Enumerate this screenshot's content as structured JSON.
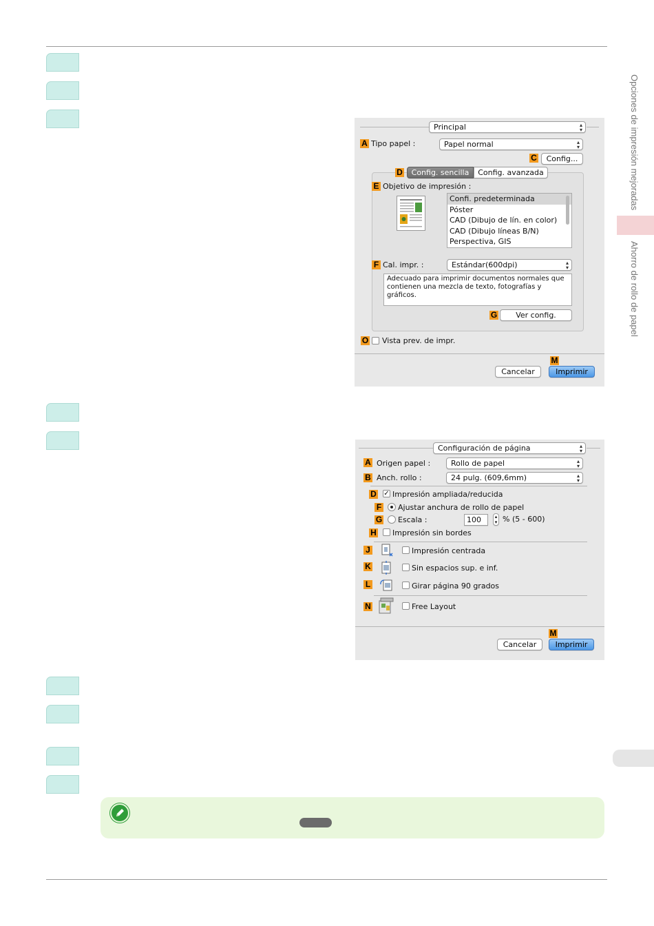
{
  "side_tabs": {
    "section": "Opciones de impresión mejoradas",
    "subsection": "Ahorro de rollo de papel"
  },
  "dialog1": {
    "panel_popup": "Principal",
    "tipo_papel_label": "Tipo papel :",
    "tipo_papel_value": "Papel normal",
    "config_button": "Config...",
    "tab_simple": "Config. sencilla",
    "tab_advanced": "Config. avanzada",
    "objetivo_label": "Objetivo de impresión :",
    "objetivo_items": [
      "Confi. predeterminada",
      "Póster",
      "CAD (Dibujo de lín. en color)",
      "CAD (Dibujo líneas B/N)",
      "Perspectiva, GIS"
    ],
    "cal_label": "Cal. impr. :",
    "cal_value": "Estándar(600dpi)",
    "description": "Adecuado para imprimir documentos normales que contienen una mezcla de texto, fotografías y gráficos.",
    "ver_config_button": "Ver config.",
    "preview_label": "Vista prev. de impr.",
    "cancel_button": "Cancelar",
    "print_button": "Imprimir",
    "tags": {
      "a": "A",
      "c": "C",
      "d": "D",
      "e": "E",
      "f": "F",
      "g": "G",
      "o": "O",
      "m": "M"
    }
  },
  "dialog2": {
    "panel_popup": "Configuración de página",
    "origen_label": "Origen papel :",
    "origen_value": "Rollo de papel",
    "anch_label": "Anch. rollo :",
    "anch_value": "24 pulg. (609,6mm)",
    "ampliada_label": "Impresión ampliada/reducida",
    "ajustar_label": "Ajustar anchura de rollo de papel",
    "escala_label": "Escala :",
    "escala_value": "100",
    "escala_range": "% (5 - 600)",
    "sin_bordes_label": "Impresión sin bordes",
    "centrada_label": "Impresión centrada",
    "sin_espacios_label": "Sin espacios sup. e inf.",
    "girar_label": "Girar página 90 grados",
    "free_layout_label": "Free Layout",
    "cancel_button": "Cancelar",
    "print_button": "Imprimir",
    "tags": {
      "a": "A",
      "b": "B",
      "d": "D",
      "f": "F",
      "g": "G",
      "h": "H",
      "j": "J",
      "k": "K",
      "l": "L",
      "n": "N",
      "m": "M"
    }
  }
}
